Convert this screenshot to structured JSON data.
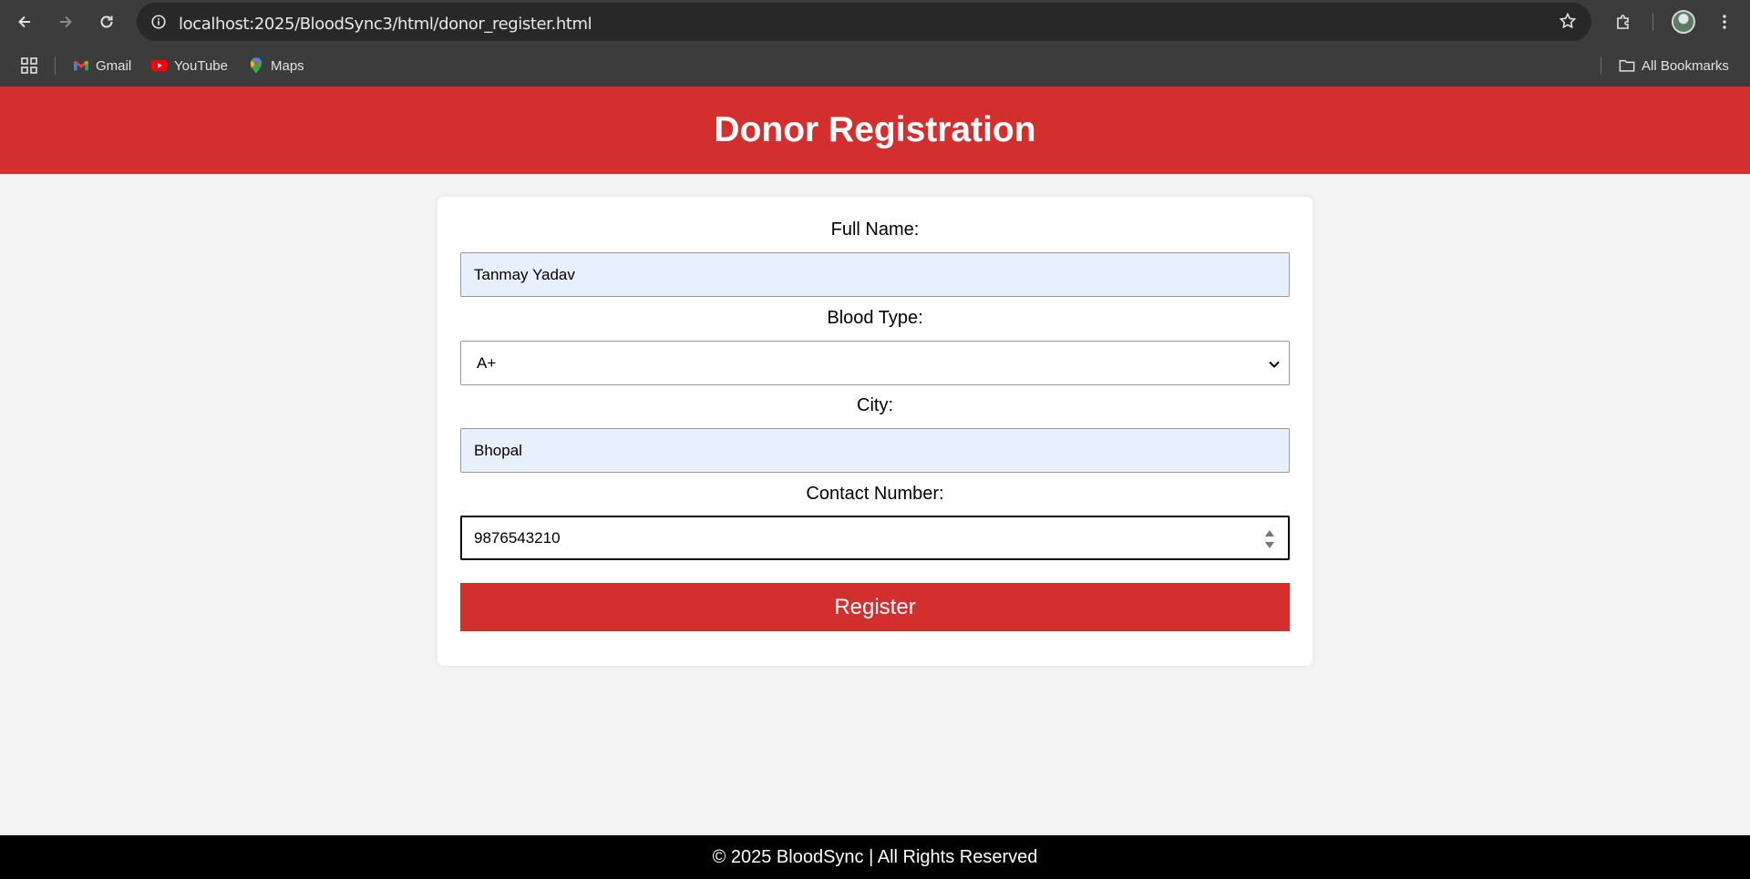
{
  "browser": {
    "url": "localhost:2025/BloodSync3/html/donor_register.html",
    "bookmarks": [
      {
        "label": "Gmail",
        "icon": "gmail-icon"
      },
      {
        "label": "YouTube",
        "icon": "youtube-icon"
      },
      {
        "label": "Maps",
        "icon": "maps-icon"
      }
    ],
    "all_bookmarks_label": "All Bookmarks"
  },
  "header": {
    "title": "Donor Registration",
    "background": "#d32f2f"
  },
  "form": {
    "full_name_label": "Full Name:",
    "full_name_value": "Tanmay Yadav",
    "blood_type_label": "Blood Type:",
    "blood_type_value": "A+",
    "city_label": "City:",
    "city_value": "Bhopal",
    "contact_label": "Contact Number:",
    "contact_value": "9876543210",
    "register_label": "Register"
  },
  "footer": {
    "text": "© 2025 BloodSync | All Rights Reserved"
  }
}
